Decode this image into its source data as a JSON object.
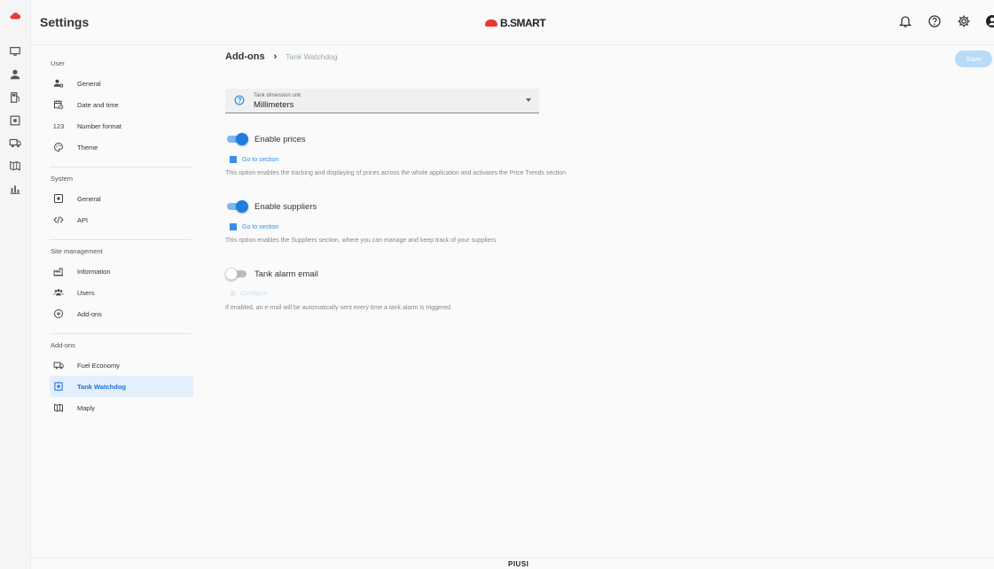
{
  "header": {
    "title": "Settings",
    "brand": "B.SMART"
  },
  "top_icons": [
    "bell-icon",
    "help-icon",
    "gear-icon",
    "account-icon"
  ],
  "rail": [
    "cloud-icon",
    "monitor-icon",
    "user-icon",
    "fuel-icon",
    "tank-icon",
    "truck-icon",
    "map-icon",
    "chart-icon"
  ],
  "sidebar": {
    "sections": [
      {
        "title": "User",
        "items": [
          {
            "label": "General",
            "icon": "user-settings-icon"
          },
          {
            "label": "Date and time",
            "icon": "calendar-clock-icon"
          },
          {
            "label": "Number format",
            "icon": "number-icon"
          },
          {
            "label": "Theme",
            "icon": "palette-icon"
          }
        ]
      },
      {
        "title": "System",
        "items": [
          {
            "label": "General",
            "icon": "system-icon"
          },
          {
            "label": "API",
            "icon": "code-icon"
          }
        ]
      },
      {
        "title": "Site management",
        "items": [
          {
            "label": "Information",
            "icon": "factory-icon"
          },
          {
            "label": "Users",
            "icon": "users-icon"
          },
          {
            "label": "Add-ons",
            "icon": "plus-circle-icon"
          }
        ]
      },
      {
        "title": "Add-ons",
        "items": [
          {
            "label": "Fuel Economy",
            "icon": "truck-icon"
          },
          {
            "label": "Tank Watchdog",
            "icon": "tank-icon",
            "active": true
          },
          {
            "label": "Maply",
            "icon": "map-icon"
          }
        ]
      }
    ]
  },
  "main": {
    "breadcrumb": {
      "root": "Add-ons",
      "separator": "›",
      "current": "Tank Watchdog"
    },
    "save_label": "Save",
    "unit_field": {
      "label": "Tank dimension unit",
      "value": "Millimeters"
    },
    "toggles": [
      {
        "label": "Enable prices",
        "on": true,
        "link": "Go to section",
        "description": "This option enables the tracking and displaying of prices across the whole application and activates the Price Trends section"
      },
      {
        "label": "Enable suppliers",
        "on": true,
        "link": "Go to section",
        "description": "This option enables the Suppliers section, where you can manage and keep track of your suppliers"
      },
      {
        "label": "Tank alarm email",
        "on": false,
        "link": "Configure",
        "description": "If enabled, an e-mail will be automatically sent every time a tank alarm is triggered"
      }
    ]
  },
  "footer": {
    "logo": "PIUSI"
  },
  "colors": {
    "accent": "#1e7ee0",
    "active_bg": "#e3f0fb",
    "save_bg": "#b7dcfa",
    "brand_red": "#e53935"
  }
}
